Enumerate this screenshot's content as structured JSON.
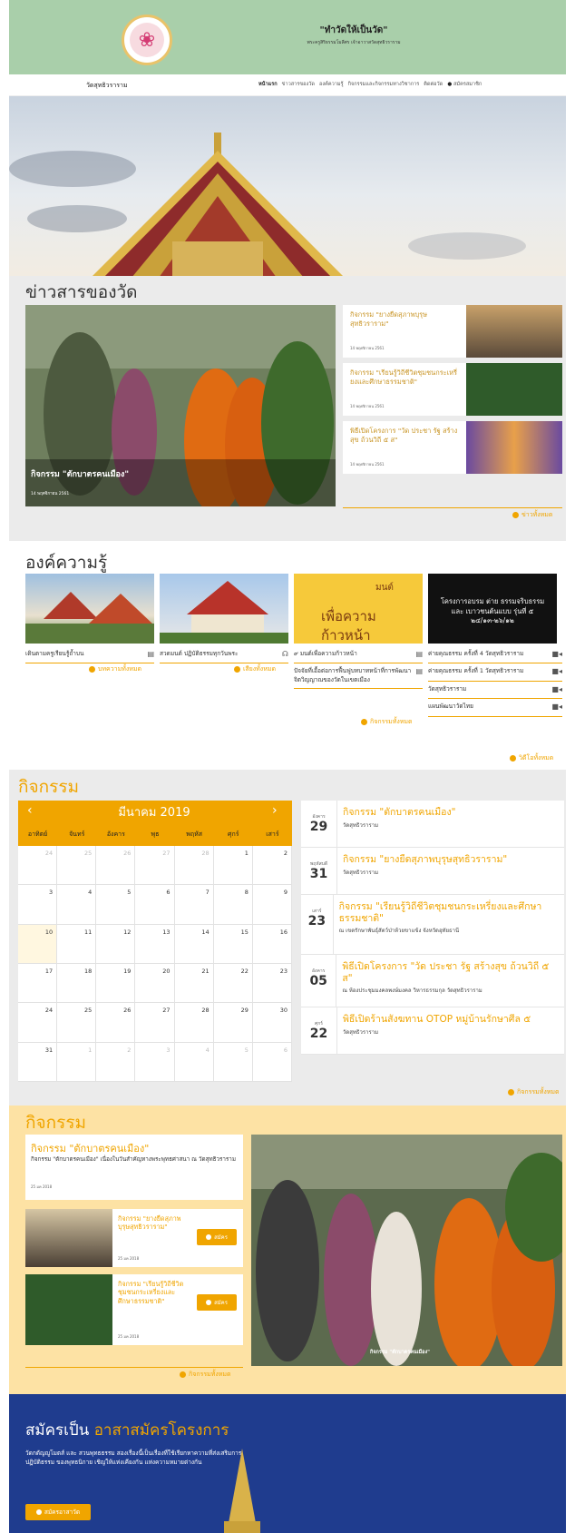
{
  "header": {
    "slogan": "\"ทำวัดให้เป็นวัด\"",
    "subslogan": "พระครูสิริธรรมโมลีศร เจ้าอาวาสวัดสุทธิวราราม",
    "logo_icon": "lotus-seal-icon"
  },
  "nav": {
    "site_name": "วัดสุทธิวราราม",
    "links": [
      "หน้าแรก",
      "ข่าวสารของวัด",
      "องค์ความรู้",
      "กิจกรรมและกิจกรรมทางวิชาการ",
      "ติดต่อวัด",
      "สมัครสมาชิก"
    ]
  },
  "news": {
    "title": "ข่าวสารของวัด",
    "main": {
      "caption": "กิจกรรม \"ตักบาตรคนเมือง\"",
      "date": "14 พฤศจิกายน 2561"
    },
    "items": [
      {
        "title": "กิจกรรม \"ยางยืดสุภาพบุรุษสุทธิวราราม\"",
        "date": "14 พฤศจิกายน 2561"
      },
      {
        "title": "กิจกรรม \"เรียนรู้วิถีชีวิตชุมชนกระเหรี่ยงและศึกษาธรรมชาติ\"",
        "date": "14 พฤศจิกายน 2561"
      },
      {
        "title": "พิธีเปิดโครงการ \"วัด ประชา รัฐ สร้างสุข ถ้วนวิถี ๕ ส\"",
        "date": "14 พฤศจิกายน 2561"
      }
    ],
    "all_label": "ข่าวทั้งหมด"
  },
  "knowledge": {
    "title": "องค์ความรู้",
    "img4_text": "โครงการอบรม ต่าย ธรรมจริบธรรม และ เบาวชนต้นแบบ รุ่นที่ ๕ ๒๔/๑๓-๒๖/๑๒",
    "img3_text_a": "มนต์",
    "img3_text_b": "เพื่อความ",
    "img3_text_c": "ก้าวหน้า",
    "col1": {
      "items": [
        "เดินตามครูเรียนรู้ถ้ำบน"
      ],
      "all": "บทความทั้งหมด"
    },
    "col2": {
      "items": [
        "สวดมนต์ ปฏิบัติธรรมทุกวันพระ"
      ],
      "all": "เสียงทั้งหมด"
    },
    "col3": {
      "items": [
        "๙ มนต์เพื่อความก้าวหน้า",
        "ปัจจัยที่เอื้อต่อการฟื้นฟูบทบาทหน้าที่การพัฒนาจิตวิญญาณของวัดในเขตเมือง"
      ],
      "all": "กิจกรรมทั้งหมด"
    },
    "col4": {
      "items": [
        "ค่ายคุณธรรม ครั้งที่ 4 วัดสุทธิวราราม",
        "ค่ายคุณธรรม ครั้งที่ 1 วัดสุทธิวราราม",
        "วัดสุทธิวราราม",
        "แผนพัฒนาวัดไทย"
      ],
      "all": "วิดีโอทั้งหมด"
    }
  },
  "calendar": {
    "title": "กิจกรรม",
    "month": "มีนาคม 2019",
    "dow": [
      "อาทิตย์",
      "จันทร์",
      "อังคาร",
      "พุธ",
      "พฤหัส",
      "ศุกร์",
      "เสาร์"
    ],
    "cells": [
      "24",
      "25",
      "26",
      "27",
      "28",
      "1",
      "2",
      "3",
      "4",
      "5",
      "6",
      "7",
      "8",
      "9",
      "10",
      "11",
      "12",
      "13",
      "14",
      "15",
      "16",
      "17",
      "18",
      "19",
      "20",
      "21",
      "22",
      "23",
      "24",
      "25",
      "26",
      "27",
      "28",
      "29",
      "30",
      "31",
      "1",
      "2",
      "3",
      "4",
      "5",
      "6"
    ],
    "all_label": "กิจกรรมทั้งหมด"
  },
  "events": [
    {
      "dow": "อังคาร",
      "day": "29",
      "title": "กิจกรรม \"ตักบาตรคนเมือง\"",
      "loc": "วัดสุทธิวราราม"
    },
    {
      "dow": "พฤหัสบดี",
      "day": "31",
      "title": "กิจกรรม \"ยางยืดสุภาพบุรุษสุทธิวราราม\"",
      "loc": "วัดสุทธิวราราม"
    },
    {
      "dow": "เสาร์",
      "day": "23",
      "title": "กิจกรรม \"เรียนรู้วิถีชีวิตชุมชนกระเหรี่ยงและศึกษาธรรมชาติ\"",
      "loc": "ณ เขตรักษาพันธุ์สัตว์ป่าห้วยขาแข้ง จังหวัดอุทัยธานี"
    },
    {
      "dow": "อังคาร",
      "day": "05",
      "title": "พิธีเปิดโครงการ \"วัด ประชา รัฐ สร้างสุข ถ้วนวิถี ๕ ส\"",
      "loc": "ณ ห้องประชุมมงคลพงษ์มงคล วิหารธรรมกุล วัดสุทธิวราราม"
    },
    {
      "dow": "ศุกร์",
      "day": "22",
      "title": "พิธีเปิดร้านสังฆทาน OTOP หมู่บ้านรักษาศีล ๕",
      "loc": "วัดสุทธิวราราม"
    }
  ],
  "activities": {
    "title": "กิจกรรม",
    "main": {
      "title": "กิจกรรม \"ตักบาตรคนเมือง\"",
      "summary": "กิจกรรม \"ตักบาตรคนเมือง\" เนื่องในวันสำคัญทางพระพุทธศาสนา ณ วัดสุทธิวราราม",
      "date": "25 มค 2018"
    },
    "cards": [
      {
        "title": "กิจกรรม \"ยางยืดสุภาพบุรุษสุทธิวราราม\"",
        "date": "25 มค 2018",
        "btn": "สมัคร"
      },
      {
        "title": "กิจกรรม \"เรียนรู้วิถีชีวิตชุมชนกระเหรี่ยงและศึกษาธรรมชาติ\"",
        "date": "25 มค 2018",
        "btn": "สมัคร"
      }
    ],
    "photo_caption": "กิจกรรม \"ตักบาตรคนเมือง\"",
    "all_label": "กิจกรรมทั้งหมด"
  },
  "volunteer": {
    "title_a": "สมัครเป็น ",
    "title_b": "อาสาสมัครโครงการ",
    "text": "วัดกตัญญูโมตส์ และ สวนพุทธธรรม สองเรื่องนี้เป็นเรื่องที่ใช้เรียกหาความที่ส่งเสริมการปฏิบัติธรรม ของพุทธนิกาย เชิญให้แห่งเคียงกัน แห่งความหมายต่างกัน",
    "btn": "สมัครอาสาวัด"
  },
  "colors": {
    "accent": "#f0a500",
    "header": "#a9cfaa",
    "volunteer": "#1f3c8e",
    "activity_bg": "#fde2a4"
  }
}
